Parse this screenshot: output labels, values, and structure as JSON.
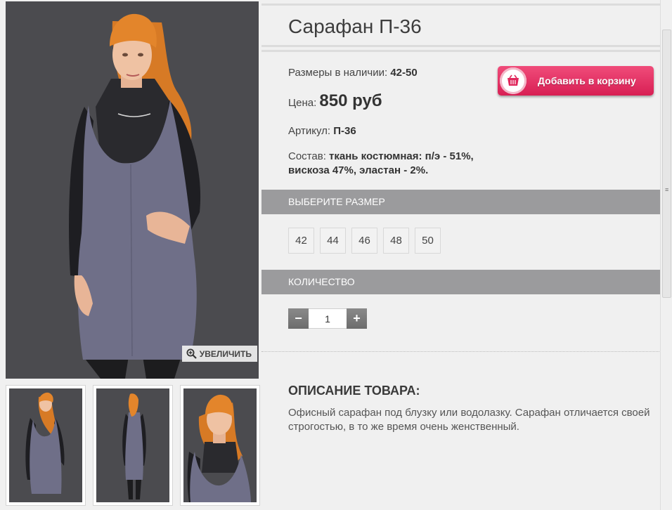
{
  "gallery": {
    "zoom_label": "УВЕЛИЧИТЬ",
    "thumbnails": [
      "front",
      "back",
      "front-closeup"
    ]
  },
  "product": {
    "title": "Сарафан П-36",
    "sizes_available_label": "Размеры в наличии:",
    "sizes_available_value": "42-50",
    "price_label": "Цена:",
    "price_value": "850 руб",
    "article_label": "Артикул:",
    "article_value": "П-36",
    "composition_label": "Состав:",
    "composition_value": "ткань костюмная: п/э - 51%, вискоза 47%, эластан - 2%."
  },
  "cart_button": {
    "label": "Добавить в корзину",
    "icon": "basket-icon",
    "color": "#e0285c"
  },
  "size_section": {
    "heading": "ВЫБЕРИТЕ РАЗМЕР",
    "options": [
      "42",
      "44",
      "46",
      "48",
      "50"
    ]
  },
  "quantity_section": {
    "heading": "КОЛИЧЕСТВО",
    "minus": "−",
    "plus": "+",
    "value": "1"
  },
  "description": {
    "heading": "ОПИСАНИЕ ТОВАРА:",
    "text": "Офисный сарафан под блузку или водолазку. Сарафан отличается своей строгостью, в то же время очень женственный."
  },
  "colors": {
    "section_header": "#9b9b9d",
    "dress": "#6e6e86",
    "hair": "#e0832a"
  }
}
